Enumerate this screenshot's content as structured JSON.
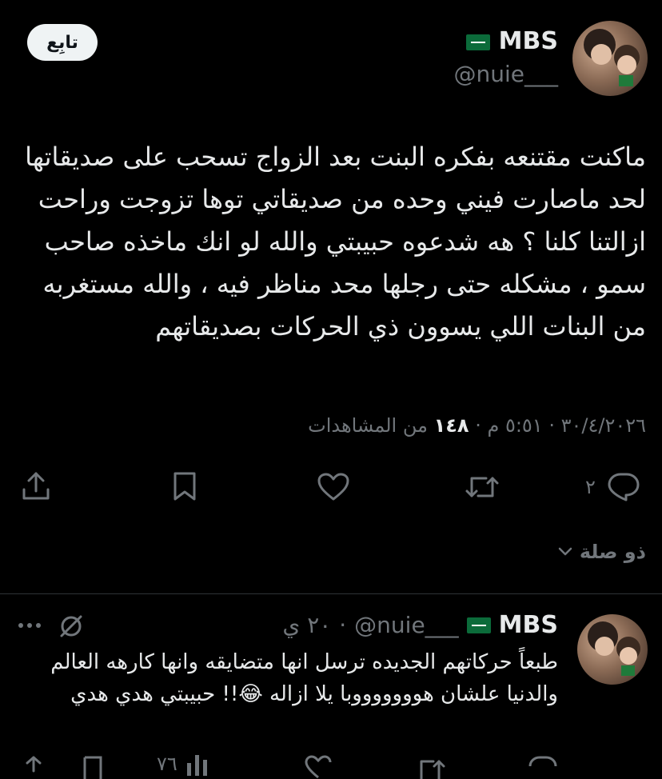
{
  "main_tweet": {
    "author_name": "MBS",
    "author_handle": "@nuie___",
    "follow_label": "تابِع",
    "text": "ماكنت مقتنعه بفكره البنت بعد الزواج تسحب على صديقاتها لحد ماصارت فيني وحده من صديقاتي توها تزوجت وراحت ازالتنا كلنا ؟ هه شدعوه حبيبتي والله لو انك ماخذه صاحب سمو ، مشكله حتى رجلها محد مناظر فيه ، والله مستغربه من البنات اللي يسوون ذي الحركات بصديقاتهم",
    "timestamp": "٣٠/٤/٢٠٢٦ · ٥:٥١ م · ",
    "views_count": "١٤٨",
    "views_label": "من المشاهدات",
    "reply_count": "٢"
  },
  "related": {
    "label": "ذو صلة"
  },
  "reply_tweet": {
    "author_name": "MBS",
    "author_handle": "@nuie___",
    "time": "٢٠ ي",
    "text": "طبعاً حركاتهم الجديده ترسل انها متضايقه وانها كارهه العالم والدنيا علشان هوووووووبا يلا ازاله 😂!! حبيبتي هدي هدي",
    "views_count": "٧٦"
  },
  "colors": {
    "background": "#000000",
    "text": "#e7e9ea",
    "muted": "#71767b",
    "divider": "#2f3336"
  }
}
